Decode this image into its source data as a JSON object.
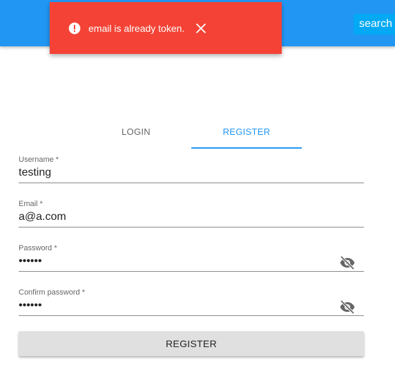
{
  "header": {
    "search_label": "search"
  },
  "snackbar": {
    "message": "email is already token.",
    "icon": "error-icon",
    "close_icon": "close-icon",
    "color": "#f44336"
  },
  "tabs": [
    {
      "label": "LOGIN",
      "active": false
    },
    {
      "label": "REGISTER",
      "active": true
    }
  ],
  "form": {
    "username": {
      "label": "Username *",
      "value": "testing"
    },
    "email": {
      "label": "Email *",
      "value": "a@a.com"
    },
    "password": {
      "label": "Password *",
      "value": "••••••",
      "icon": "visibility-off-icon"
    },
    "confirm_password": {
      "label": "Confirm password *",
      "value": "••••••",
      "icon": "visibility-off-icon"
    },
    "submit_label": "REGISTER"
  },
  "colors": {
    "appbar": "#2196f3",
    "accent": "#2196f3",
    "error": "#f44336"
  }
}
